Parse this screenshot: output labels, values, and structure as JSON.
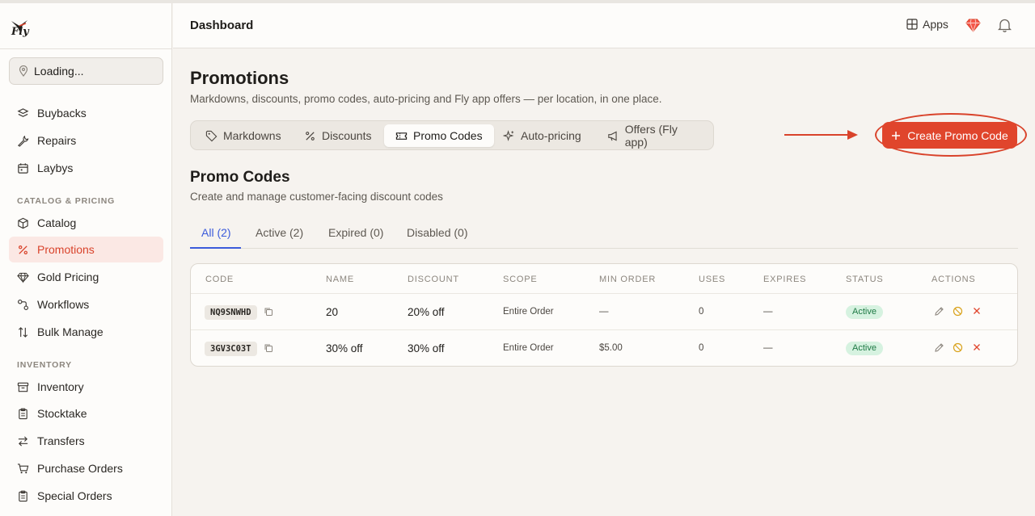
{
  "brand": {
    "logo_text": "Fly"
  },
  "sidebar": {
    "location": "Loading...",
    "items_top": [
      {
        "label": "Buybacks",
        "icon": "buyback-icon"
      },
      {
        "label": "Repairs",
        "icon": "wrench-icon"
      },
      {
        "label": "Laybys",
        "icon": "calendar-icon"
      }
    ],
    "section_catalog": "CATALOG & PRICING",
    "items_catalog": [
      {
        "label": "Catalog",
        "icon": "box-icon"
      },
      {
        "label": "Promotions",
        "icon": "percent-icon",
        "active": true
      },
      {
        "label": "Gold Pricing",
        "icon": "gem-icon"
      },
      {
        "label": "Workflows",
        "icon": "workflow-icon"
      },
      {
        "label": "Bulk Manage",
        "icon": "sort-icon"
      }
    ],
    "section_inventory": "INVENTORY",
    "items_inventory": [
      {
        "label": "Inventory",
        "icon": "archive-icon"
      },
      {
        "label": "Stocktake",
        "icon": "clipboard-icon"
      },
      {
        "label": "Transfers",
        "icon": "transfer-icon"
      },
      {
        "label": "Purchase Orders",
        "icon": "cart-icon"
      },
      {
        "label": "Special Orders",
        "icon": "clipboard-icon"
      }
    ]
  },
  "header": {
    "title": "Dashboard",
    "apps_label": "Apps"
  },
  "page": {
    "title": "Promotions",
    "subtitle": "Markdowns, discounts, promo codes, auto-pricing and Fly app offers — per location, in one place.",
    "tabs": [
      "Markdowns",
      "Discounts",
      "Promo Codes",
      "Auto-pricing",
      "Offers (Fly app)"
    ],
    "active_tab": "Promo Codes",
    "create_button": "Create Promo Code"
  },
  "promo": {
    "title": "Promo Codes",
    "subtitle": "Create and manage customer-facing discount codes",
    "filters": [
      "All (2)",
      "Active (2)",
      "Expired (0)",
      "Disabled (0)"
    ],
    "columns": [
      "CODE",
      "NAME",
      "DISCOUNT",
      "SCOPE",
      "MIN ORDER",
      "USES",
      "EXPIRES",
      "STATUS",
      "ACTIONS"
    ],
    "rows": [
      {
        "code": "NQ9SNWHD",
        "name": "20",
        "discount": "20% off",
        "scope": "Entire Order",
        "min_order": "—",
        "uses": "0",
        "expires": "—",
        "status": "Active"
      },
      {
        "code": "3GV3C03T",
        "name": "30% off",
        "discount": "30% off",
        "scope": "Entire Order",
        "min_order": "$5.00",
        "uses": "0",
        "expires": "—",
        "status": "Active"
      }
    ]
  },
  "colors": {
    "accent": "#e0452c",
    "link": "#3b5bdb",
    "active_badge": "#d6f2e0"
  }
}
